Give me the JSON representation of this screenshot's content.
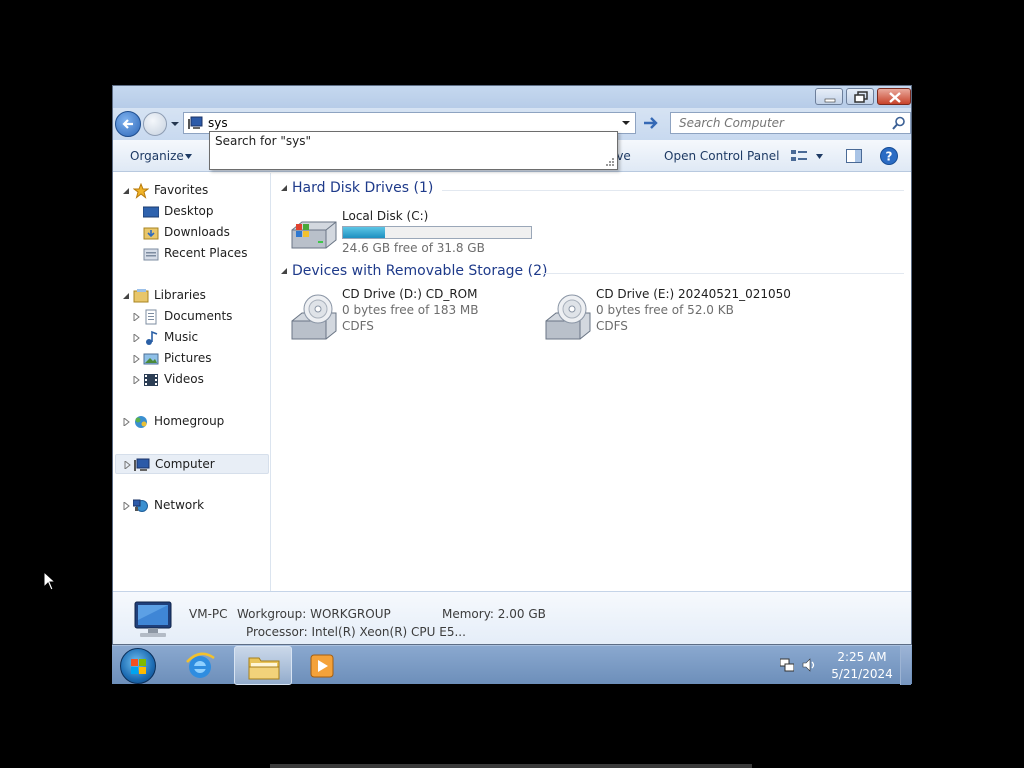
{
  "address": {
    "value": "sys"
  },
  "search": {
    "placeholder": "Search Computer"
  },
  "suggestion": {
    "label": "Search for \"sys\""
  },
  "toolbar": {
    "organize": "Organize",
    "partial_label": "ive",
    "open_control_panel": "Open Control Panel"
  },
  "nav": {
    "favorites": "Favorites",
    "desktop": "Desktop",
    "downloads": "Downloads",
    "recent_places": "Recent Places",
    "libraries": "Libraries",
    "documents": "Documents",
    "music": "Music",
    "pictures": "Pictures",
    "videos": "Videos",
    "homegroup": "Homegroup",
    "computer": "Computer",
    "network": "Network"
  },
  "content": {
    "hdd_group": "Hard Disk Drives (1)",
    "removable_group": "Devices with Removable Storage (2)",
    "local_disk": {
      "name": "Local Disk (C:)",
      "space": "24.6 GB free of 31.8 GB",
      "used_fraction": 0.226
    },
    "cd_d": {
      "name": "CD Drive (D:) CD_ROM",
      "space": "0 bytes free of 183 MB",
      "fs": "CDFS"
    },
    "cd_e": {
      "name": "CD Drive (E:) 20240521_021050",
      "space": "0 bytes free of 52.0 KB",
      "fs": "CDFS"
    }
  },
  "details": {
    "computer_name": "VM-PC",
    "workgroup": "Workgroup: WORKGROUP",
    "memory": "Memory: 2.00 GB",
    "processor": "Processor: Intel(R) Xeon(R) CPU E5..."
  },
  "taskbar": {
    "time": "2:25 AM",
    "date": "5/21/2024"
  },
  "colors": {
    "link_blue": "#1e3a8a",
    "progress": "#1e90c0",
    "taskbar": "#7a9ac4"
  }
}
